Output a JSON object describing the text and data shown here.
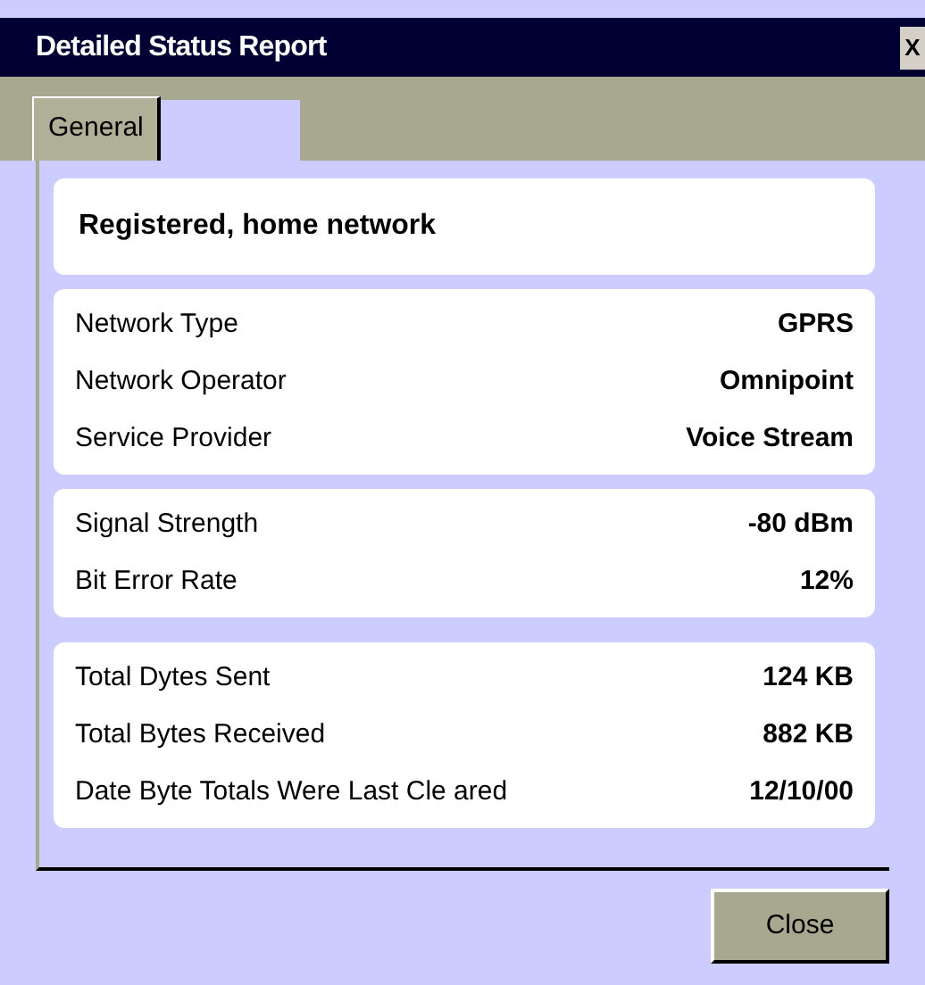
{
  "window": {
    "title": "Detailed Status Report",
    "close_glyph": "X"
  },
  "tabs": [
    {
      "label": "General",
      "selected": true
    }
  ],
  "status": "Registered, home network",
  "groups": [
    {
      "rows": [
        {
          "label": "Network Type",
          "value": "GPRS"
        },
        {
          "label": "Network Operator",
          "value": "Omnipoint"
        },
        {
          "label": "Service Provider",
          "value": "Voice Stream"
        }
      ]
    },
    {
      "rows": [
        {
          "label": "Signal Strength",
          "value": "-80 dBm"
        },
        {
          "label": "Bit Error Rate",
          "value": "12%"
        }
      ]
    },
    {
      "rows": [
        {
          "label": "Total Dytes Sent",
          "value": "124 KB"
        },
        {
          "label": "Total Bytes Received",
          "value": "882 KB"
        },
        {
          "label": "Date Byte Totals Were Last Cle ared",
          "value": "12/10/00"
        }
      ]
    }
  ],
  "buttons": [
    {
      "label": "Close"
    }
  ]
}
